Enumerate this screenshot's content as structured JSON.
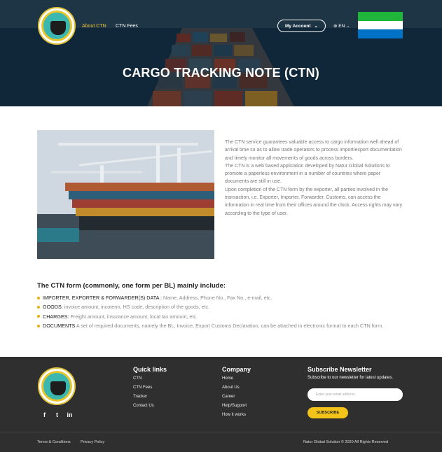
{
  "header": {
    "nav": [
      {
        "label": "About CTN",
        "active": true
      },
      {
        "label": "CTN Fees",
        "active": false
      }
    ],
    "account_label": "My Account",
    "lang_label": "EN",
    "flag_colors": [
      "#1eb53a",
      "#ffffff",
      "#0072c6"
    ],
    "title": "CARGO TRACKING NOTE (CTN)"
  },
  "intro": {
    "paragraphs": [
      "The CTN service guarantees valuable access to cargo information well ahead of arrival time so as to allow trade operators to process import/export documentation and timely monitor all movements of goods across borders.",
      "The CTN is a web based application developed by Natur Global Solutions to promote a paperless environment in a number of countries where paper documents are still in use.",
      "Upon completion of the CTN form by the exporter, all parties involved in the transaction, i.e. Exporter, Importer, Forwarder, Customs, can access the information in real time from their offices around the clock. Access rights may vary according to the type of user."
    ]
  },
  "form_list": {
    "title": "The CTN form (commonly, one form per BL) mainly include:",
    "items": [
      {
        "label": "IMPORTER, EXPORTER & FORWARDER(S) DATA :",
        "text": " Name, Address, Phone No., Fax No., e-mail, etc."
      },
      {
        "label": "GOODS:",
        "text": " invoice amount, incoterm, HS code, description of the goods, etc."
      },
      {
        "label": "CHARGES:",
        "text": " Freight amount, insurance amount, local tax amount, etc."
      },
      {
        "label": "DOCUMENTS",
        "text": " A set of required documents, namely the BL, Invoice, Export Customs Declaration, can be attached in electronic format to each CTN form."
      }
    ]
  },
  "footer": {
    "social": [
      "f",
      "t",
      "in"
    ],
    "quick_links": {
      "title": "Quick links",
      "items": [
        "CTN",
        "CTN Fees",
        "Tracker",
        "Contact Us"
      ]
    },
    "company": {
      "title": "Company",
      "items": [
        "Home",
        "About Us",
        "Career",
        "Help/Support",
        "How it works"
      ]
    },
    "newsletter": {
      "title": "Subscribe Newsletter",
      "text": "Subscribe to our newsletter for latest updates.",
      "placeholder": "Enter your email address",
      "button": "SUBSCRIBE"
    },
    "bottom_links": [
      "Terms & Conditions",
      "Privacy Policy"
    ],
    "copyright": "Natur Global Solution © 2020 All Rights Reserved"
  }
}
